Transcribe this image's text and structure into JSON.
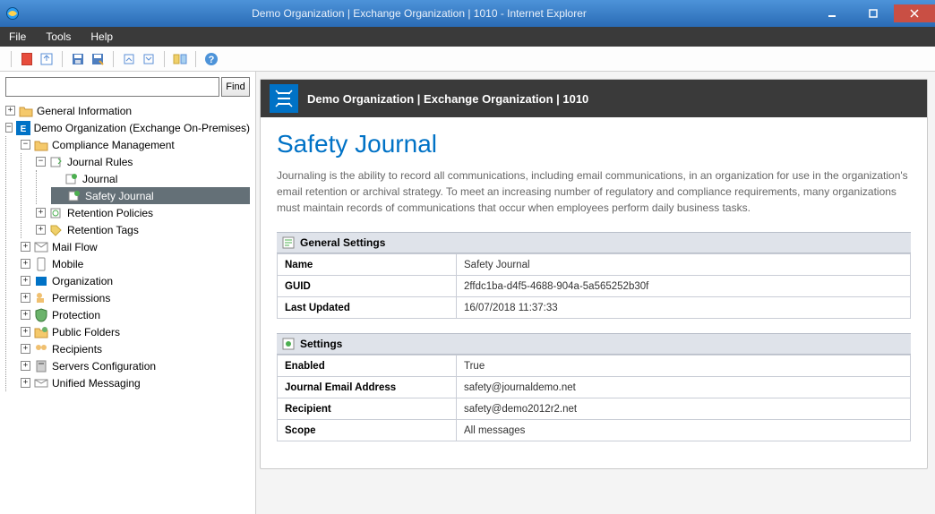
{
  "window": {
    "title": "Demo Organization | Exchange Organization | 1010 - Internet Explorer"
  },
  "menu": {
    "file": "File",
    "tools": "Tools",
    "help": "Help"
  },
  "search": {
    "placeholder": "",
    "find_label": "Find"
  },
  "tree": {
    "general_info": "General Information",
    "demo_org": "Demo Organization (Exchange On-Premises)",
    "compliance": "Compliance Management",
    "journal_rules": "Journal Rules",
    "journal": "Journal",
    "safety_journal": "Safety Journal",
    "retention_policies": "Retention Policies",
    "retention_tags": "Retention Tags",
    "mail_flow": "Mail Flow",
    "mobile": "Mobile",
    "organization": "Organization",
    "permissions": "Permissions",
    "protection": "Protection",
    "public_folders": "Public Folders",
    "recipients": "Recipients",
    "servers_config": "Servers Configuration",
    "unified_messaging": "Unified Messaging"
  },
  "header": {
    "title": "Demo Organization | Exchange Organization | 1010"
  },
  "page": {
    "title": "Safety Journal",
    "description": "Journaling is the ability to record all communications, including email communications, in an organization for use in the organization's email retention or archival strategy. To meet an increasing number of regulatory and compliance requirements, many organizations must maintain records of communications that occur when employees perform daily business tasks."
  },
  "sections": {
    "general": {
      "title": "General Settings",
      "rows": {
        "name_k": "Name",
        "name_v": "Safety Journal",
        "guid_k": "GUID",
        "guid_v": "2ffdc1ba-d4f5-4688-904a-5a565252b30f",
        "updated_k": "Last Updated",
        "updated_v": "16/07/2018 11:37:33"
      }
    },
    "settings": {
      "title": "Settings",
      "rows": {
        "enabled_k": "Enabled",
        "enabled_v": "True",
        "email_k": "Journal Email Address",
        "email_v": "safety@journaldemo.net",
        "recipient_k": "Recipient",
        "recipient_v": "safety@demo2012r2.net",
        "scope_k": "Scope",
        "scope_v": "All messages"
      }
    }
  }
}
